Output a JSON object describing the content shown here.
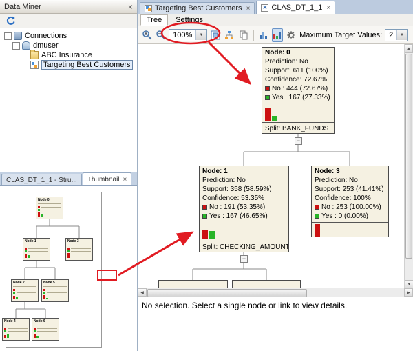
{
  "colors": {
    "annotation_red": "#e11b22",
    "node_bg": "#f5f1e2",
    "no_bar": "#cc1111",
    "yes_bar": "#28b428"
  },
  "data_miner_panel": {
    "title": "Data Miner",
    "tree_items": [
      {
        "label": "Connections"
      },
      {
        "label": "dmuser"
      },
      {
        "label": "ABC Insurance"
      },
      {
        "label": "Targeting Best Customers"
      }
    ]
  },
  "thumbnail_panel": {
    "tabs": [
      {
        "label": "CLAS_DT_1_1 - Stru..."
      },
      {
        "label": "Thumbnail"
      }
    ],
    "mini_nodes": [
      {
        "label": "Node 0"
      },
      {
        "label": "Node 1"
      },
      {
        "label": "Node 3"
      },
      {
        "label": "Node 2"
      },
      {
        "label": "Node 5"
      },
      {
        "label": "Node 4"
      },
      {
        "label": "Node 6"
      }
    ]
  },
  "editor": {
    "tabs": [
      {
        "label": "Targeting Best Customers"
      },
      {
        "label": "CLAS_DT_1_1"
      }
    ],
    "subtabs": [
      {
        "label": "Tree"
      },
      {
        "label": "Settings"
      }
    ],
    "toolbar": {
      "zoom_value": "100%",
      "max_target_label": "Maximum Target Values:",
      "max_target_value": "2"
    },
    "status_message": "No selection. Select a single node or link to view details."
  },
  "tree_nodes": {
    "node0": {
      "title": "Node: 0",
      "prediction": "Prediction: No",
      "support": "Support: 611 (100%)",
      "confidence": "Confidence: 72.67%",
      "no_label": "No : 444 (72.67%)",
      "yes_label": "Yes : 167 (27.33%)",
      "split": "Split: BANK_FUNDS",
      "bars": {
        "no": 72.67,
        "yes": 27.33
      }
    },
    "node1": {
      "title": "Node: 1",
      "prediction": "Prediction: No",
      "support": "Support: 358 (58.59%)",
      "confidence": "Confidence: 53.35%",
      "no_label": "No : 191 (53.35%)",
      "yes_label": "Yes : 167 (46.65%)",
      "split": "Split: CHECKING_AMOUNT",
      "bars": {
        "no": 53.35,
        "yes": 46.65
      }
    },
    "node3": {
      "title": "Node: 3",
      "prediction": "Prediction: No",
      "support": "Support: 253 (41.41%)",
      "confidence": "Confidence: 100%",
      "no_label": "No : 253 (100.00%)",
      "yes_label": "Yes : 0 (0.00%)",
      "bars": {
        "no": 100,
        "yes": 0
      }
    }
  }
}
